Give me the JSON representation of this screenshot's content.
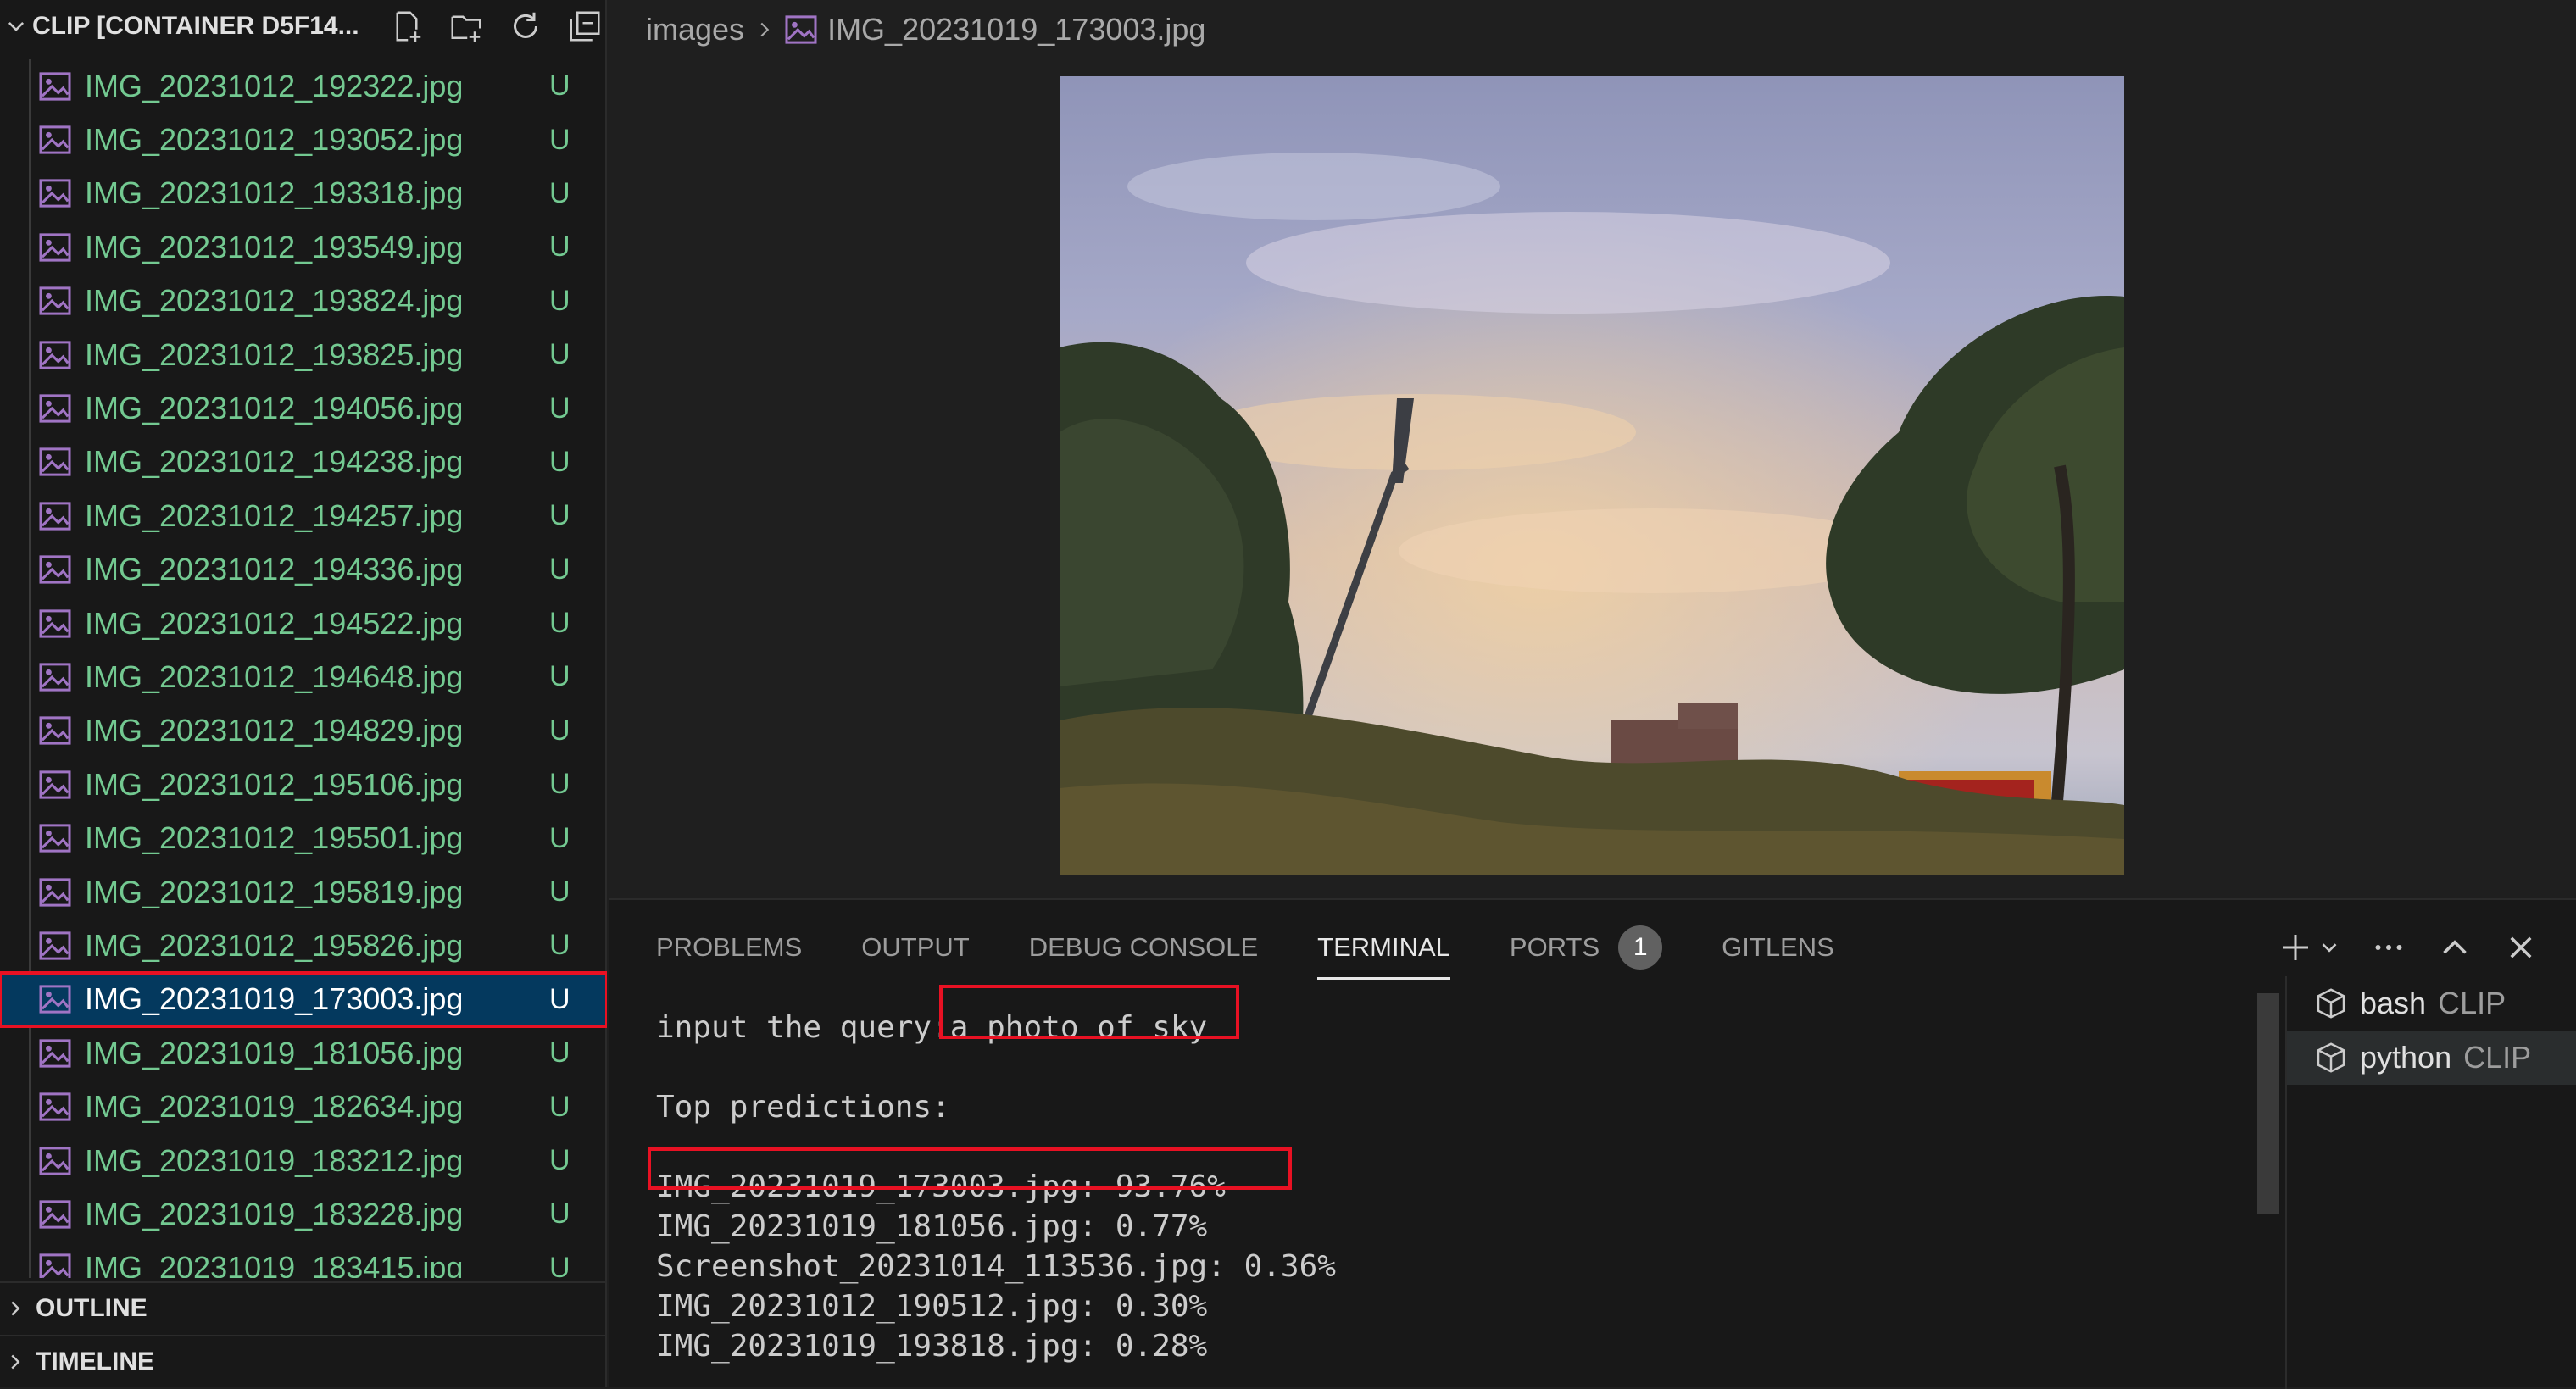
{
  "explorer": {
    "title": "CLIP [CONTAINER D5F14...",
    "actions": [
      "new-file-icon",
      "new-folder-icon",
      "refresh-icon",
      "collapse-all-icon"
    ],
    "files": [
      {
        "name": "IMG_20231012_192322.jpg",
        "status": "U"
      },
      {
        "name": "IMG_20231012_193052.jpg",
        "status": "U"
      },
      {
        "name": "IMG_20231012_193318.jpg",
        "status": "U"
      },
      {
        "name": "IMG_20231012_193549.jpg",
        "status": "U"
      },
      {
        "name": "IMG_20231012_193824.jpg",
        "status": "U"
      },
      {
        "name": "IMG_20231012_193825.jpg",
        "status": "U"
      },
      {
        "name": "IMG_20231012_194056.jpg",
        "status": "U"
      },
      {
        "name": "IMG_20231012_194238.jpg",
        "status": "U"
      },
      {
        "name": "IMG_20231012_194257.jpg",
        "status": "U"
      },
      {
        "name": "IMG_20231012_194336.jpg",
        "status": "U"
      },
      {
        "name": "IMG_20231012_194522.jpg",
        "status": "U"
      },
      {
        "name": "IMG_20231012_194648.jpg",
        "status": "U"
      },
      {
        "name": "IMG_20231012_194829.jpg",
        "status": "U"
      },
      {
        "name": "IMG_20231012_195106.jpg",
        "status": "U"
      },
      {
        "name": "IMG_20231012_195501.jpg",
        "status": "U"
      },
      {
        "name": "IMG_20231012_195819.jpg",
        "status": "U"
      },
      {
        "name": "IMG_20231012_195826.jpg",
        "status": "U"
      },
      {
        "name": "IMG_20231019_173003.jpg",
        "status": "U",
        "selected": true
      },
      {
        "name": "IMG_20231019_181056.jpg",
        "status": "U"
      },
      {
        "name": "IMG_20231019_182634.jpg",
        "status": "U"
      },
      {
        "name": "IMG_20231019_183212.jpg",
        "status": "U"
      },
      {
        "name": "IMG_20231019_183228.jpg",
        "status": "U"
      },
      {
        "name": "IMG_20231019_183415.jpg",
        "status": "U"
      }
    ]
  },
  "sections": {
    "outline": "OUTLINE",
    "timeline": "TIMELINE"
  },
  "breadcrumb": {
    "folder": "images",
    "file": "IMG_20231019_173003.jpg"
  },
  "panel": {
    "tabs": [
      "PROBLEMS",
      "OUTPUT",
      "DEBUG CONSOLE",
      "TERMINAL",
      "PORTS",
      "GITLENS"
    ],
    "active_tab": "TERMINAL",
    "ports_badge": "1"
  },
  "terminal": {
    "prompt": "input the query:",
    "query": "a photo of sky",
    "heading": "Top predictions:",
    "results": [
      "IMG_20231019_173003.jpg: 93.76%",
      "IMG_20231019_181056.jpg: 0.77%",
      "Screenshot_20231014_113536.jpg: 0.36%",
      "IMG_20231012_190512.jpg: 0.30%",
      "IMG_20231019_193818.jpg: 0.28%"
    ]
  },
  "terminal_list": [
    {
      "name": "bash",
      "sub": "CLIP"
    },
    {
      "name": "python",
      "sub": "CLIP",
      "active": true
    }
  ],
  "colors": {
    "untracked": "#73c991",
    "selection": "#04395e",
    "highlight": "#e81123",
    "background": "#1f1f1f"
  }
}
